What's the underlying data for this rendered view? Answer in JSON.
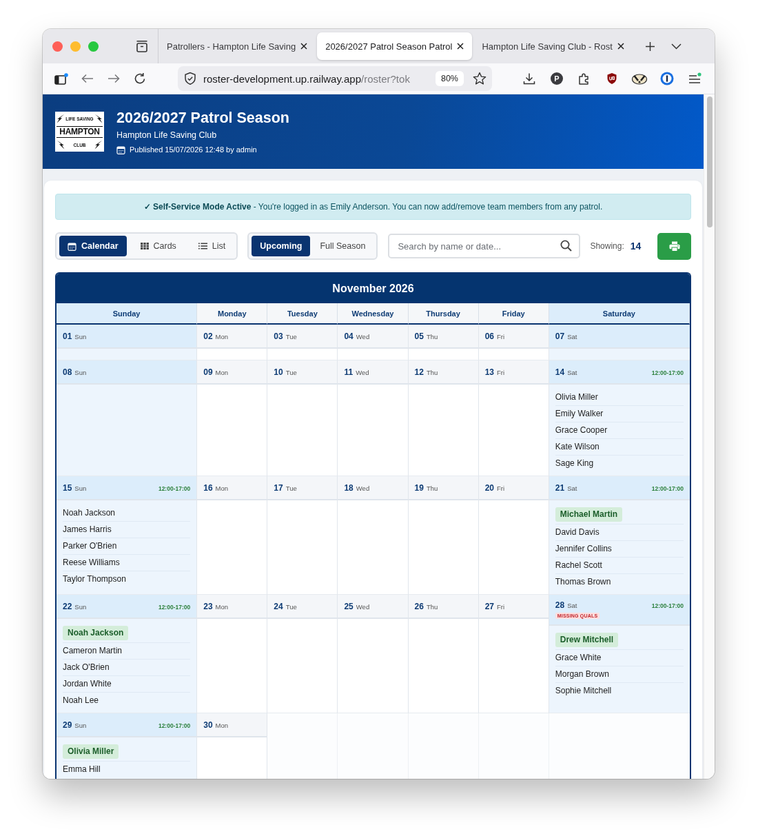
{
  "browser": {
    "tabs": [
      {
        "title": "Patrollers - Hampton Life Saving",
        "selected": false
      },
      {
        "title": "2026/2027 Patrol Season Patrol",
        "selected": true
      },
      {
        "title": "Hampton Life Saving Club - Rost",
        "selected": false
      }
    ],
    "address": {
      "host": "roster-development.up.railway.app",
      "path": "/roster?tok",
      "zoom": "80%"
    },
    "extension_letter": "P"
  },
  "header": {
    "logo": {
      "arc": "LIFE SAVING",
      "name": "HAMPTON",
      "sub": "CLUB"
    },
    "title": "2026/2027 Patrol Season",
    "club": "Hampton Life Saving Club",
    "published": "Published 15/07/2026 12:48 by admin"
  },
  "notice": "**✓ Self-Service Mode Active** - You're logged in as Emily Anderson. You can now add/remove team members from any patrol.",
  "views": [
    {
      "label": "Calendar",
      "kind": "calendar",
      "selected": true
    },
    {
      "label": "Cards",
      "kind": "cards",
      "selected": false
    },
    {
      "label": "List",
      "kind": "list",
      "selected": false
    }
  ],
  "ranges": [
    {
      "label": "Upcoming",
      "selected": true
    },
    {
      "label": "Full Season",
      "selected": false
    }
  ],
  "search": {
    "placeholder": "Search by name or date..."
  },
  "showing": {
    "label": "Showing:",
    "count": "14"
  },
  "calendar": {
    "month": "November 2026",
    "weekdays": [
      {
        "name": "Sunday",
        "weekend": true
      },
      {
        "name": "Monday",
        "weekend": false
      },
      {
        "name": "Tuesday",
        "weekend": false
      },
      {
        "name": "Wednesday",
        "weekend": false
      },
      {
        "name": "Thursday",
        "weekend": false
      },
      {
        "name": "Friday",
        "weekend": false
      },
      {
        "name": "Saturday",
        "weekend": true
      }
    ],
    "weeks": [
      {
        "days": [
          {
            "date": "01",
            "day": "Sun",
            "weekend": true
          },
          {
            "date": "02",
            "day": "Mon",
            "weekend": false
          },
          {
            "date": "03",
            "day": "Tue",
            "weekend": false
          },
          {
            "date": "04",
            "day": "Wed",
            "weekend": false
          },
          {
            "date": "05",
            "day": "Thu",
            "weekend": false
          },
          {
            "date": "06",
            "day": "Fri",
            "weekend": false
          },
          {
            "date": "07",
            "day": "Sat",
            "weekend": true
          }
        ]
      },
      {
        "days": [
          {
            "date": "08",
            "day": "Sun",
            "weekend": true
          },
          {
            "date": "09",
            "day": "Mon",
            "weekend": false
          },
          {
            "date": "10",
            "day": "Tue",
            "weekend": false
          },
          {
            "date": "11",
            "day": "Wed",
            "weekend": false
          },
          {
            "date": "12",
            "day": "Thu",
            "weekend": false
          },
          {
            "date": "13",
            "day": "Fri",
            "weekend": false
          },
          {
            "date": "14",
            "day": "Sat",
            "weekend": true,
            "time": "12:00-17:00",
            "members": [
              {
                "name": "Olivia Miller",
                "leader": false
              },
              {
                "name": "Emily Walker",
                "leader": false
              },
              {
                "name": "Grace Cooper",
                "leader": false
              },
              {
                "name": "Kate Wilson",
                "leader": false
              },
              {
                "name": "Sage King",
                "leader": false
              }
            ]
          }
        ]
      },
      {
        "days": [
          {
            "date": "15",
            "day": "Sun",
            "weekend": true,
            "time": "12:00-17:00",
            "members": [
              {
                "name": "Noah Jackson",
                "leader": false
              },
              {
                "name": "James Harris",
                "leader": false
              },
              {
                "name": "Parker O'Brien",
                "leader": false
              },
              {
                "name": "Reese Williams",
                "leader": false
              },
              {
                "name": "Taylor Thompson",
                "leader": false
              }
            ]
          },
          {
            "date": "16",
            "day": "Mon",
            "weekend": false
          },
          {
            "date": "17",
            "day": "Tue",
            "weekend": false
          },
          {
            "date": "18",
            "day": "Wed",
            "weekend": false
          },
          {
            "date": "19",
            "day": "Thu",
            "weekend": false
          },
          {
            "date": "20",
            "day": "Fri",
            "weekend": false
          },
          {
            "date": "21",
            "day": "Sat",
            "weekend": true,
            "time": "12:00-17:00",
            "members": [
              {
                "name": "Michael Martin",
                "leader": true
              },
              {
                "name": "David Davis",
                "leader": false
              },
              {
                "name": "Jennifer Collins",
                "leader": false
              },
              {
                "name": "Rachel Scott",
                "leader": false
              },
              {
                "name": "Thomas Brown",
                "leader": false
              }
            ]
          }
        ]
      },
      {
        "days": [
          {
            "date": "22",
            "day": "Sun",
            "weekend": true,
            "time": "12:00-17:00",
            "members": [
              {
                "name": "Noah Jackson",
                "leader": true
              },
              {
                "name": "Cameron Martin",
                "leader": false
              },
              {
                "name": "Jack O'Brien",
                "leader": false
              },
              {
                "name": "Jordan White",
                "leader": false
              },
              {
                "name": "Noah Lee",
                "leader": false
              }
            ]
          },
          {
            "date": "23",
            "day": "Mon",
            "weekend": false
          },
          {
            "date": "24",
            "day": "Tue",
            "weekend": false
          },
          {
            "date": "25",
            "day": "Wed",
            "weekend": false
          },
          {
            "date": "26",
            "day": "Thu",
            "weekend": false
          },
          {
            "date": "27",
            "day": "Fri",
            "weekend": false
          },
          {
            "date": "28",
            "day": "Sat",
            "weekend": true,
            "time": "12:00-17:00",
            "alert": "MISSING QUALS",
            "members": [
              {
                "name": "Drew Mitchell",
                "leader": true
              },
              {
                "name": "Grace White",
                "leader": false
              },
              {
                "name": "Morgan Brown",
                "leader": false
              },
              {
                "name": "Sophie Mitchell",
                "leader": false
              }
            ]
          }
        ]
      },
      {
        "days": [
          {
            "date": "29",
            "day": "Sun",
            "weekend": true,
            "time": "12:00-17:00",
            "members": [
              {
                "name": "Olivia Miller",
                "leader": true
              },
              {
                "name": "Emma Hill",
                "leader": false
              }
            ]
          },
          {
            "date": "30",
            "day": "Mon",
            "weekend": false
          }
        ]
      }
    ]
  }
}
